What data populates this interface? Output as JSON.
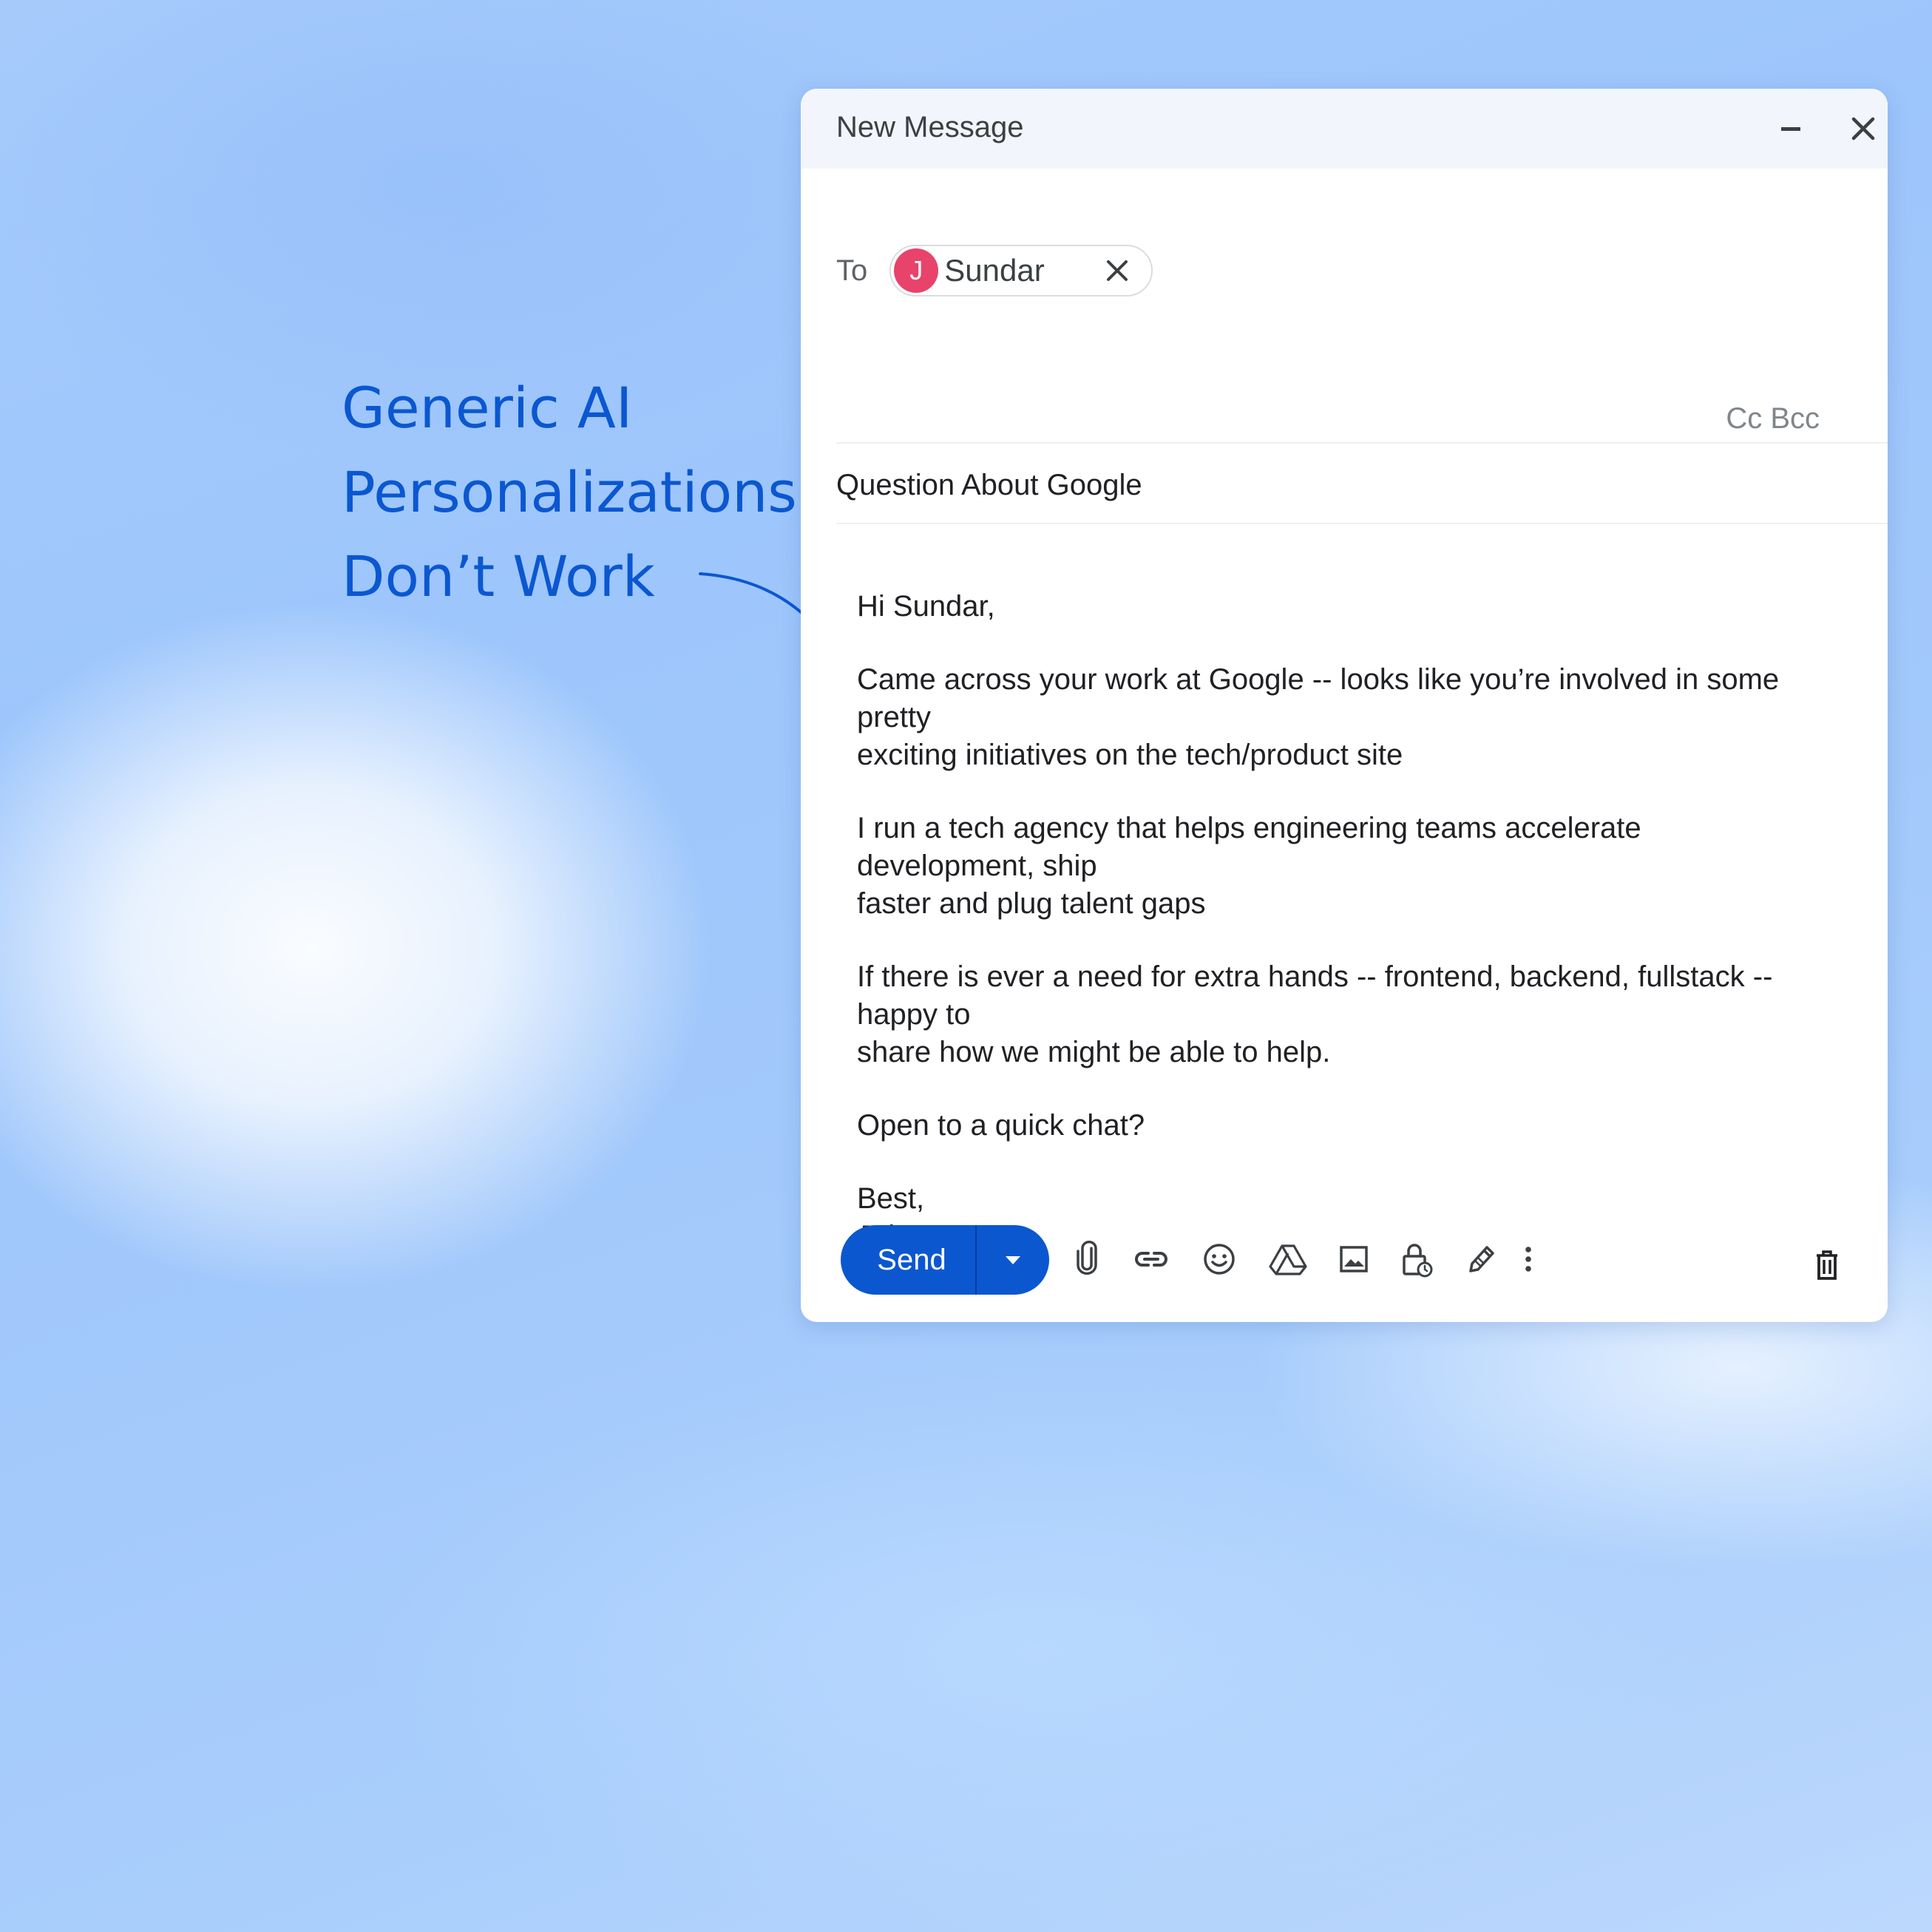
{
  "headline": {
    "lines": [
      "Generic AI",
      "Personalizations",
      "Don’t Work"
    ],
    "color": "#0b57d0"
  },
  "compose": {
    "title": "New Message",
    "header_icons": [
      "minimize-icon",
      "close-icon"
    ],
    "to_label": "To",
    "recipient": {
      "initial": "J",
      "name": "Sundar",
      "avatar_color": "#e8436b"
    },
    "cc_bcc": "Cc Bcc",
    "subject": "Question About Google",
    "body": {
      "greeting": "Hi Sundar,",
      "paragraph1": "Came across your work at Google -- looks like you’re involved in some\npretty\nexciting initiatives on the tech/product site",
      "paragraph2": "I run a tech agency that helps engineering teams accelerate\ndevelopment, ship\nfaster and plug talent gaps",
      "paragraph3": "If there is ever a need for extra hands -- frontend, backend, fullstack --\nhappy to\nshare how we might be able to help.",
      "question": "Open to a quick chat?",
      "signoff": "Best,",
      "signature": "John"
    },
    "toolbar": {
      "send_label": "Send",
      "send_color": "#0b57d0",
      "icons": [
        "attach-icon",
        "link-icon",
        "emoji-icon",
        "drive-icon",
        "photo-icon",
        "confidential-icon",
        "signature-icon",
        "more-options-icon",
        "trash-icon"
      ]
    }
  }
}
